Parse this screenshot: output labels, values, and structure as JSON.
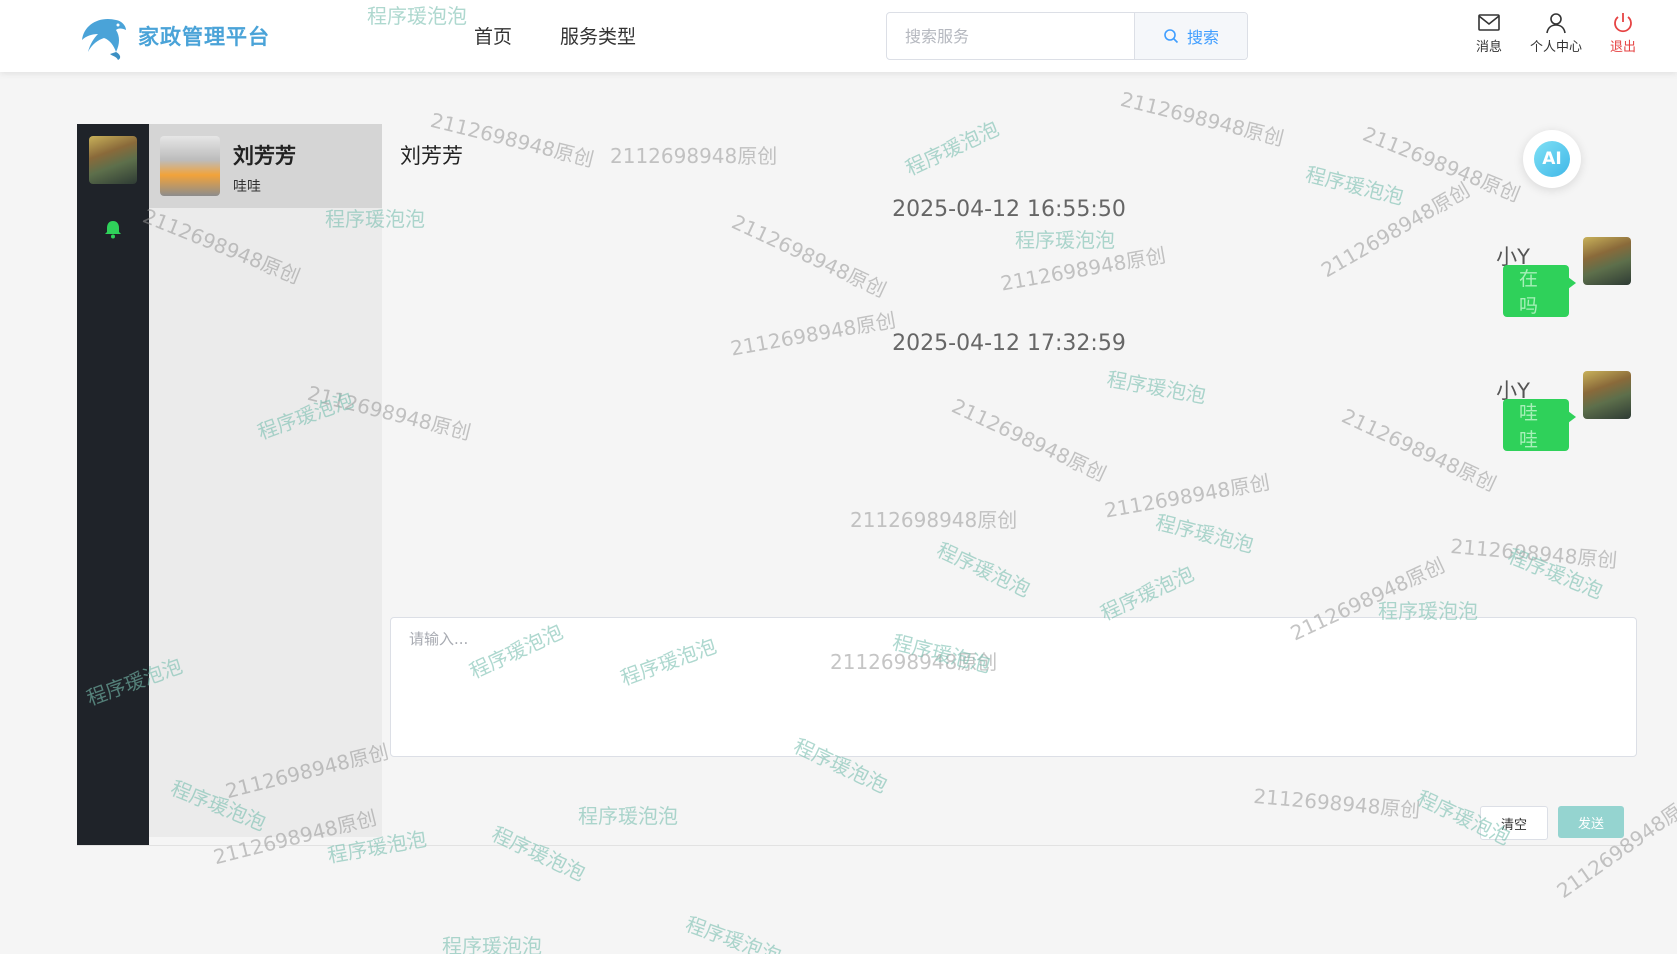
{
  "header": {
    "brand_name": "家政管理平台",
    "nav": [
      "首页",
      "服务类型"
    ],
    "search": {
      "placeholder": "搜索服务",
      "button_label": "搜索"
    },
    "icons": [
      {
        "label": "消息",
        "icon": "mail-icon",
        "color": "#333333"
      },
      {
        "label": "个人中心",
        "icon": "user-icon",
        "color": "#333333"
      },
      {
        "label": "退出",
        "icon": "power-icon",
        "color": "#e64343"
      }
    ]
  },
  "contacts": [
    {
      "name": "刘芳芳",
      "last_message": "哇哇",
      "active": true
    }
  ],
  "chat": {
    "title": "刘芳芳",
    "ai_label": "AI",
    "messages": [
      {
        "timestamp": "2025-04-12 16:55:50",
        "sender": "小Y",
        "text": "在吗"
      },
      {
        "timestamp": "2025-04-12 17:32:59",
        "sender": "小Y",
        "text": "哇哇"
      }
    ],
    "input_placeholder": "请输入...",
    "clear_label": "清空",
    "send_label": "发送"
  },
  "watermarks": {
    "text_a": "2112698948原创",
    "text_b": "程序瑗泡泡"
  },
  "colors": {
    "accent": "#409eff",
    "bubble": "#2fd15a",
    "send": "#95d4d0",
    "sidebar": "#1f2329"
  }
}
